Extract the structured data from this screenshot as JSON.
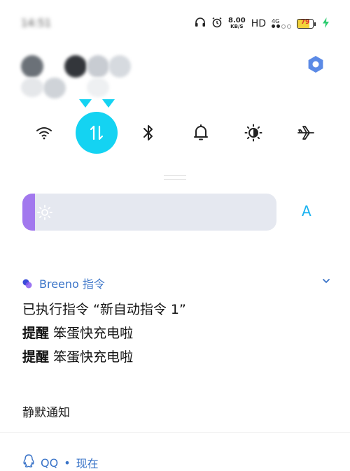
{
  "status_bar": {
    "time": "14:51",
    "net_speed_value": "8.00",
    "net_speed_unit": "KB/S",
    "hd": "HD",
    "network": "4G",
    "battery": "79",
    "battery_level": 79,
    "icons": [
      "headphones-icon",
      "alarm-icon",
      "charging-icon"
    ]
  },
  "quick_toggles": [
    {
      "name": "wifi",
      "icon": "wifi-icon",
      "active": false
    },
    {
      "name": "mobile-data",
      "icon": "data-transfer-icon",
      "active": true
    },
    {
      "name": "bluetooth",
      "icon": "bluetooth-icon",
      "active": false
    },
    {
      "name": "ring",
      "icon": "bell-icon",
      "active": false
    },
    {
      "name": "brightness-mode",
      "icon": "contrast-icon",
      "active": false
    },
    {
      "name": "airplane",
      "icon": "airplane-icon",
      "active": false
    }
  ],
  "brightness": {
    "level": 0.05,
    "auto_label": "A"
  },
  "notification": {
    "app_name": "Breeno 指令",
    "line1": "已执行指令 “新自动指令 1”",
    "reminder_label": "提醒",
    "reminder_text": "笨蛋快充电啦"
  },
  "section": {
    "silent_label": "静默通知"
  },
  "next_notification": {
    "app": "QQ",
    "time": "现在",
    "separator": " • "
  },
  "colors": {
    "accent": "#14d3f2",
    "brightness_fill": "#a278ee",
    "link_blue": "#3a74c8"
  }
}
